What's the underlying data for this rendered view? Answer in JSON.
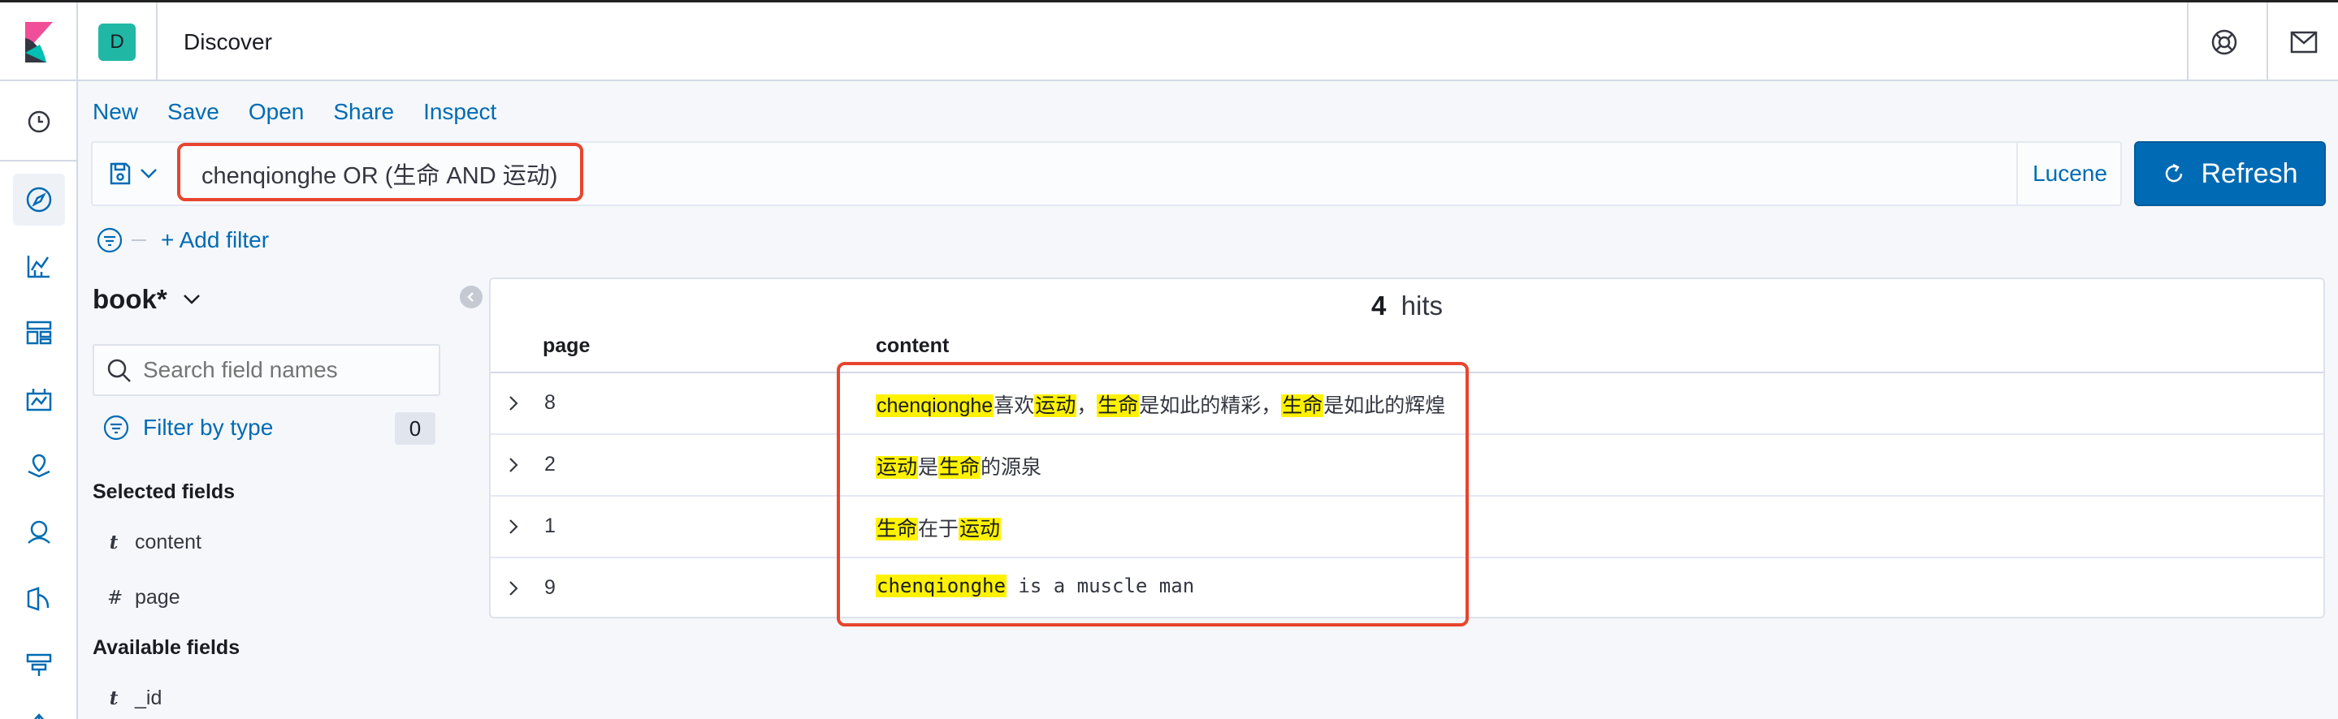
{
  "header": {
    "space_initial": "D",
    "app_title": "Discover"
  },
  "top_nav": {
    "items": [
      "New",
      "Save",
      "Open",
      "Share",
      "Inspect"
    ]
  },
  "query_bar": {
    "query": "chenqionghe OR (生命 AND 运动)",
    "language": "Lucene",
    "refresh_label": "Refresh"
  },
  "filters": {
    "add_filter_label": "+ Add filter"
  },
  "sidebar": {
    "index_pattern": "book*",
    "field_search_placeholder": "Search field names",
    "filter_by_type_label": "Filter by type",
    "filter_count": "0",
    "selected_fields_title": "Selected fields",
    "selected_fields": [
      {
        "type": "t",
        "name": "content"
      },
      {
        "type": "#",
        "name": "page"
      }
    ],
    "available_fields_title": "Available fields",
    "available_fields": [
      {
        "type": "t",
        "name": "_id"
      }
    ]
  },
  "results": {
    "hits_count": "4",
    "hits_label": "hits",
    "columns": [
      "page",
      "content"
    ],
    "rows": [
      {
        "page": "8",
        "content": [
          {
            "text": "chenqionghe",
            "hl": true
          },
          {
            "text": "喜欢",
            "hl": false
          },
          {
            "text": "运动",
            "hl": true
          },
          {
            "text": "，",
            "hl": false
          },
          {
            "text": "生命",
            "hl": true
          },
          {
            "text": "是如此的精彩，",
            "hl": false
          },
          {
            "text": "生命",
            "hl": true
          },
          {
            "text": "是如此的辉煌",
            "hl": false
          }
        ]
      },
      {
        "page": "2",
        "content": [
          {
            "text": "运动",
            "hl": true
          },
          {
            "text": "是",
            "hl": false
          },
          {
            "text": "生命",
            "hl": true
          },
          {
            "text": "的源泉",
            "hl": false
          }
        ]
      },
      {
        "page": "1",
        "content": [
          {
            "text": "生命",
            "hl": true
          },
          {
            "text": "在于",
            "hl": false
          },
          {
            "text": "运动",
            "hl": true
          }
        ]
      },
      {
        "page": "9",
        "mono": true,
        "content": [
          {
            "text": "chenqionghe",
            "hl": true
          },
          {
            "text": " is a muscle man",
            "hl": false
          }
        ]
      }
    ]
  },
  "colors": {
    "accent": "#006bb4",
    "highlight": "#fff200",
    "annotation_red": "#e8442f",
    "space_avatar": "#20b8a5"
  },
  "icons": {
    "nav": [
      "clock-icon",
      "compass-icon",
      "visualize-icon",
      "dashboard-icon",
      "canvas-icon",
      "maps-icon",
      "ml-icon",
      "infra-icon",
      "devtools-icon",
      "uptime-icon"
    ]
  }
}
